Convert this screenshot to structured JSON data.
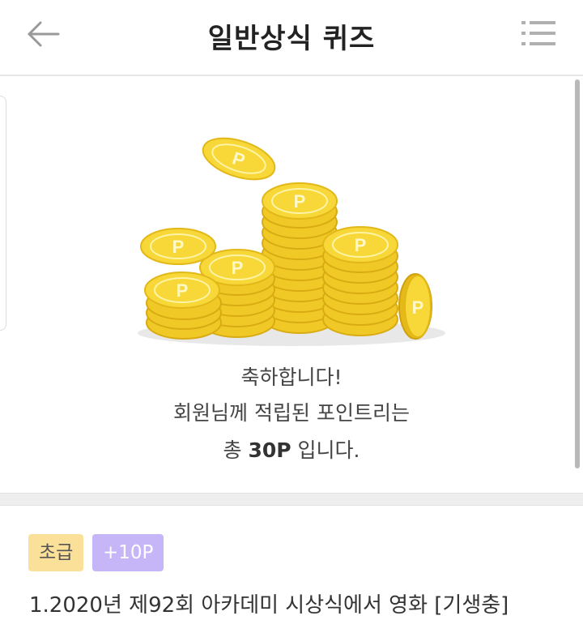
{
  "header": {
    "title": "일반상식 퀴즈",
    "back_icon": "arrow-left-icon",
    "menu_icon": "list-menu-icon"
  },
  "result": {
    "illustration": "gold-coins",
    "line1": "축하합니다!",
    "line2": "회원님께 적립된 포인트리는",
    "line3_prefix": "총 ",
    "line3_points": "30P",
    "line3_suffix": " 입니다."
  },
  "quiz": {
    "level_badge": "초급",
    "points_badge": "+10P",
    "question": "1.2020년 제92회 아카데미 시상식에서 영화 [기생충]"
  },
  "colors": {
    "coin_gold": "#f7d838",
    "coin_edge": "#e2b819",
    "level_badge_bg": "#fbe09a",
    "points_badge_bg": "#c6b6f7"
  }
}
